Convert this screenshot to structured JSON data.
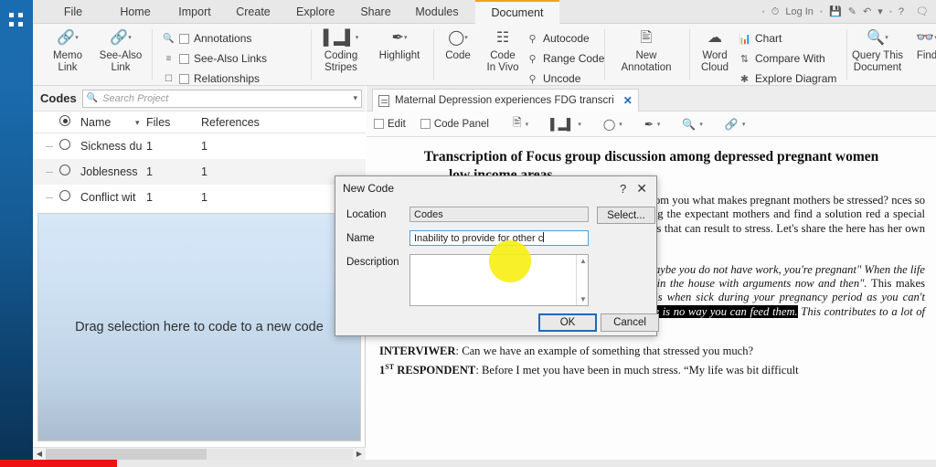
{
  "app": {
    "rail_icon": "four-dots-icon"
  },
  "ribbon": {
    "tabs": [
      {
        "label": "File",
        "active": false
      },
      {
        "label": "Home",
        "active": false
      },
      {
        "label": "Import",
        "active": false
      },
      {
        "label": "Create",
        "active": false
      },
      {
        "label": "Explore",
        "active": false
      },
      {
        "label": "Share",
        "active": false
      },
      {
        "label": "Modules",
        "active": false
      },
      {
        "label": "Document",
        "active": true
      }
    ],
    "window_controls": {
      "login": "Log In",
      "save_icon": "save-icon",
      "pen_icon": "pen-icon",
      "undo_icon": "undo-icon",
      "dropdown_icon": "chevron-down-icon",
      "help_icon": "question-mark-icon",
      "comment_icon": "comment-icon"
    },
    "groups": {
      "links": {
        "memo_link": "Memo\nLink",
        "memo_link_l1": "Memo",
        "memo_link_l2": "Link",
        "see_also_link_l1": "See-Also",
        "see_also_link_l2": "Link"
      },
      "checks": {
        "annotations": "Annotations",
        "see_also_links": "See-Also Links",
        "relationships": "Relationships"
      },
      "visual": {
        "coding_stripes_l1": "Coding",
        "coding_stripes_l2": "Stripes",
        "highlight": "Highlight"
      },
      "coding": {
        "code": "Code",
        "code_in_vivo_l1": "Code",
        "code_in_vivo_l2": "In Vivo",
        "autocode": "Autocode",
        "range_code": "Range Code",
        "uncode": "Uncode"
      },
      "annotation": {
        "new_annotation_l1": "New",
        "new_annotation_l2": "Annotation"
      },
      "explore": {
        "word_cloud_l1": "Word",
        "word_cloud_l2": "Cloud",
        "chart": "Chart",
        "compare_with": "Compare With",
        "explore_diagram": "Explore Diagram"
      },
      "query": {
        "query_this_document_l1": "Query This",
        "query_this_document_l2": "Document",
        "find": "Find"
      }
    }
  },
  "codes_panel": {
    "title": "Codes",
    "search_placeholder": "Search Project",
    "columns": [
      "Name",
      "Files",
      "References"
    ],
    "rows": [
      {
        "name": "Sickness du",
        "files": "1",
        "references": "1"
      },
      {
        "name": "Joblesness",
        "files": "1",
        "references": "1"
      },
      {
        "name": "Conflict wit",
        "files": "1",
        "references": "1"
      }
    ],
    "dropzone_text": "Drag selection here to code to a new code"
  },
  "document_pane": {
    "tab_label": "Maternal Depression experiences FDG transcri",
    "toolbar": {
      "edit": "Edit",
      "code_panel": "Code Panel",
      "annotation_icon": "annotation-icon",
      "coding_stripes_icon": "coding-stripes-icon",
      "code_icon": "code-circle-icon",
      "highlight_icon": "highlight-pen-icon",
      "zoom_icon": "zoom-icon",
      "link_icon": "link-icon"
    },
    "title_line1": "Transcription of Focus group discussion among depressed pregnant women",
    "title_line2": "low income areas",
    "paragraph1": "erience a lot of stress either from family or om you what makes pregnant mothers be stressed? nces so that when we will be presenting we can ong the expectant mothers and find a solution red a special group and you need not to be stressed. asons that can result to stress. Let's share the here has her own experiences.",
    "paragraph2_pre": "at makes us mothers be stressed is how you live. maybe you do not have work, you're pregnant\" When the life becomes a challenge the husband becomes noisy in the house with arguments now and then\". ",
    "paragraph2_mid": "This makes mothers be stressed. ",
    "paragraph2_ital": "“Other stressing situations is when sick during your pregnancy period as you can't manage yourself, ",
    "paragraph2_hl": "you have kids, no work and there is no way you can feed them.",
    "paragraph2_post": " This contributes to a lot of thoughts resulting into stress”.",
    "speaker1": "INTERVIWER",
    "speaker1_text": ": Can we have an example of something that stressed you much?",
    "speaker2": "1",
    "speaker2_sup": "ST",
    "speaker2_rest": " RESPONDENT",
    "speaker2_text": ": Before I met you have been in much stress. “My life was bit difficult"
  },
  "dialog": {
    "title": "New Code",
    "help_label": "?",
    "close_label": "✕",
    "location_label": "Location",
    "location_value": "Codes",
    "select_button": "Select...",
    "name_label": "Name",
    "name_value": "Inability to provide for other c",
    "description_label": "Description",
    "description_value": "",
    "ok_button": "OK",
    "cancel_button": "Cancel"
  },
  "colors": {
    "accent_blue": "#1e6bb8",
    "tab_underline": "#f2a11b",
    "rail_blue": "#155a93",
    "progress_red": "#ef1212",
    "cursor_yellow": "#f7ef12"
  }
}
